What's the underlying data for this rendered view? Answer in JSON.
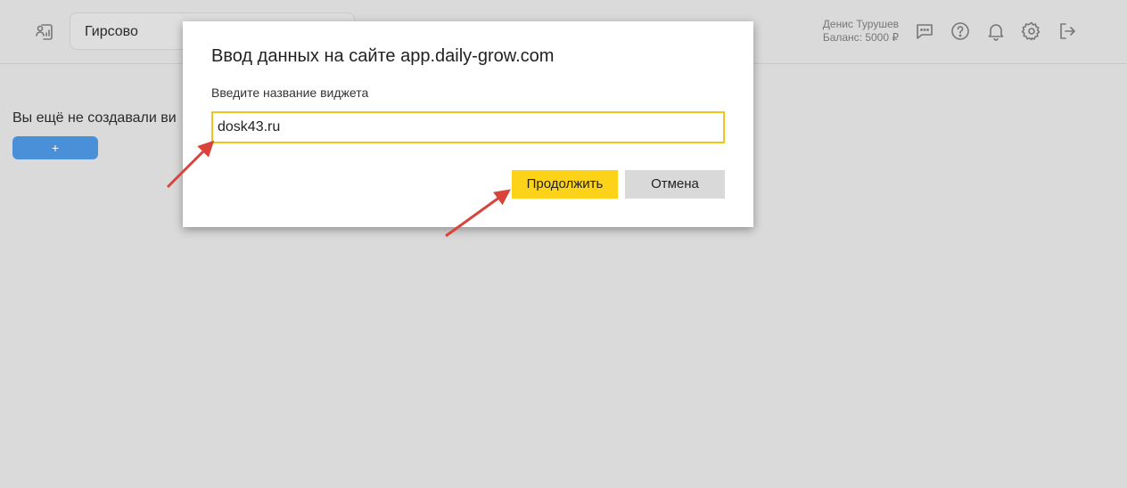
{
  "header": {
    "project_name": "Гирсово",
    "user": {
      "name": "Денис Турушев",
      "balance": "Баланс: 5000 ₽"
    },
    "icons": [
      "report-icon",
      "chat-icon",
      "help-icon",
      "bell-icon",
      "gear-icon",
      "logout-icon"
    ]
  },
  "main": {
    "empty_text": "Вы ещё не создавали ви",
    "add_button_label": "+"
  },
  "dialog": {
    "title": "Ввод данных на сайте app.daily-grow.com",
    "prompt_label": "Введите название виджета",
    "input_value": "dosk43.ru",
    "continue_label": "Продолжить",
    "cancel_label": "Отмена"
  },
  "colors": {
    "overlay_bg": "#dadada",
    "accent_yellow": "#fdd319",
    "input_border": "#f0c419",
    "add_button_blue": "#4a90d9",
    "arrow_red": "#d9443a"
  }
}
